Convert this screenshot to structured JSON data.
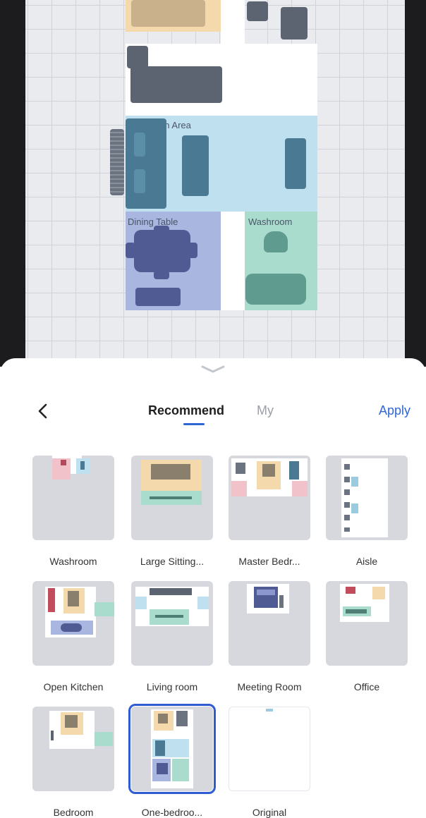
{
  "plan": {
    "rooms": [
      {
        "name": "reception",
        "label": "Reception Area",
        "color": "#bfe0ef"
      },
      {
        "name": "dining",
        "label": "Dining Table",
        "color": "#a9b6df"
      },
      {
        "name": "washroom",
        "label": "Washroom",
        "color": "#a9dccd"
      }
    ],
    "colors": {
      "top_left_area": "#f3d9ac",
      "grid_bg": "#e9ebef"
    }
  },
  "sheet": {
    "handle_icon": "chevron-down-icon",
    "back_icon": "chevron-left-icon",
    "tabs": [
      {
        "label": "Recommend",
        "active": true
      },
      {
        "label": "My",
        "active": false
      }
    ],
    "apply_label": "Apply",
    "accent": "#2f66d6",
    "templates": [
      {
        "label": "Washroom"
      },
      {
        "label": "Large Sitting..."
      },
      {
        "label": "Master Bedr..."
      },
      {
        "label": "Aisle"
      },
      {
        "label": "Open Kitchen"
      },
      {
        "label": "Living room"
      },
      {
        "label": "Meeting Room"
      },
      {
        "label": "Office"
      },
      {
        "label": "Bedroom"
      },
      {
        "label": "One-bedroo...",
        "selected": true
      },
      {
        "label": "Original"
      }
    ]
  }
}
